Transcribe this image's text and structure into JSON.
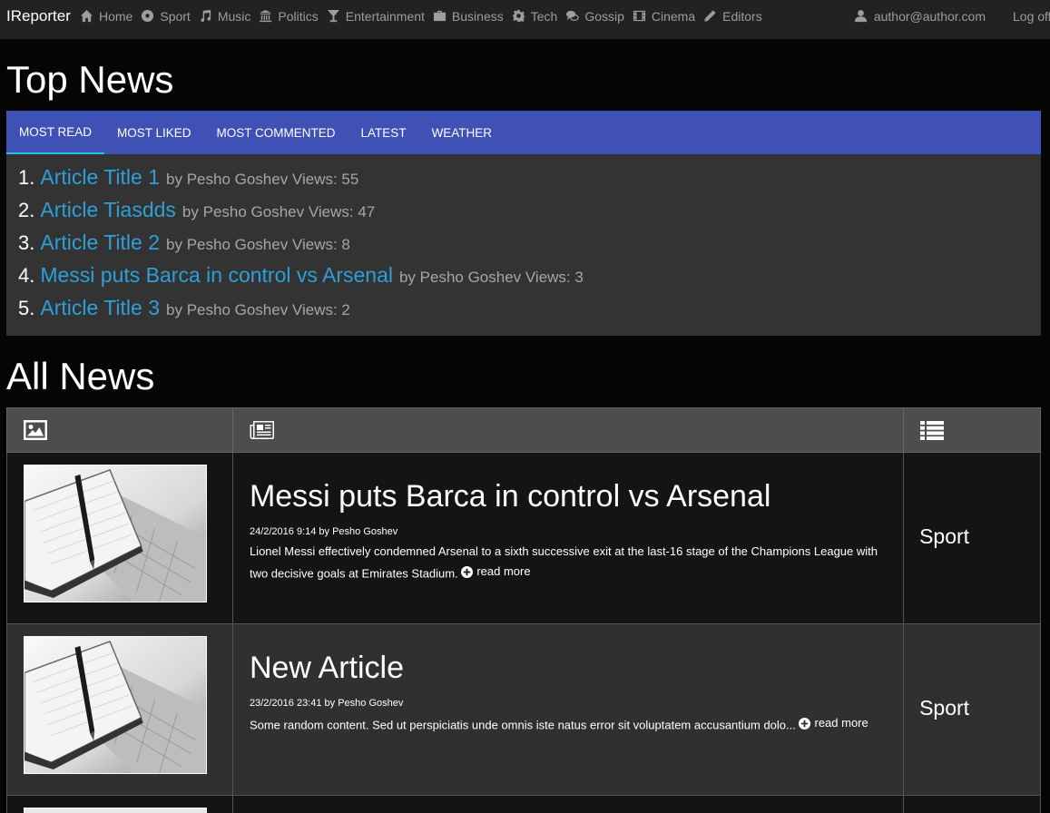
{
  "navbar": {
    "brand": "IReporter",
    "items": [
      {
        "label": "Home",
        "icon": "home-icon"
      },
      {
        "label": "Sport",
        "icon": "soccer-ball-icon"
      },
      {
        "label": "Music",
        "icon": "music-note-icon"
      },
      {
        "label": "Politics",
        "icon": "bank-icon"
      },
      {
        "label": "Entertainment",
        "icon": "cocktail-glass-icon"
      },
      {
        "label": "Business",
        "icon": "briefcase-icon"
      },
      {
        "label": "Tech",
        "icon": "gear-icon"
      },
      {
        "label": "Gossip",
        "icon": "chat-bubbles-icon"
      },
      {
        "label": "Cinema",
        "icon": "film-icon"
      },
      {
        "label": "Editors",
        "icon": "pencil-icon"
      }
    ],
    "user": "author@author.com",
    "logoff": "Log off"
  },
  "top_news": {
    "title": "Top News",
    "tabs": [
      "Most Read",
      "Most Liked",
      "Most Commented",
      "Latest",
      "Weather"
    ],
    "active_tab": "Most Read",
    "items": [
      {
        "rank": "1.",
        "title": "Article Title 1",
        "meta": "by Pesho Goshev Views: 55"
      },
      {
        "rank": "2.",
        "title": "Article Tiasdds",
        "meta": "by Pesho Goshev Views: 47"
      },
      {
        "rank": "3.",
        "title": "Article Title 2",
        "meta": "by Pesho Goshev Views: 8"
      },
      {
        "rank": "4.",
        "title": "Messi puts Barca in control vs Arsenal",
        "meta": "by Pesho Goshev Views: 3"
      },
      {
        "rank": "5.",
        "title": "Article Title 3",
        "meta": "by Pesho Goshev Views: 2"
      }
    ]
  },
  "all_news": {
    "title": "All News",
    "header_icons": [
      "picture-icon",
      "newspaper-icon",
      "list-icon"
    ],
    "articles": [
      {
        "title": "Messi puts Barca in control vs Arsenal",
        "meta": "24/2/2016 9:14 by Pesho Goshev",
        "body": "Lionel Messi effectively condemned Arsenal to a sixth successive exit at the last-16 stage of the Champions League with two decisive goals at Emirates Stadium. ",
        "read_more": "read more",
        "category": "Sport"
      },
      {
        "title": "New Article",
        "meta": "23/2/2016 23:41 by Pesho Goshev",
        "body": "Some random content. Sed ut perspiciatis unde omnis iste natus error sit voluptatem accusantium dolo... ",
        "read_more": "read more",
        "category": "Sport"
      }
    ]
  },
  "colors": {
    "navbar_bg": "#222222",
    "tab_bar": "#3f51b5",
    "tab_indicator": "#26c6da",
    "link": "#2e9fd8",
    "panel_bg": "#333333"
  }
}
